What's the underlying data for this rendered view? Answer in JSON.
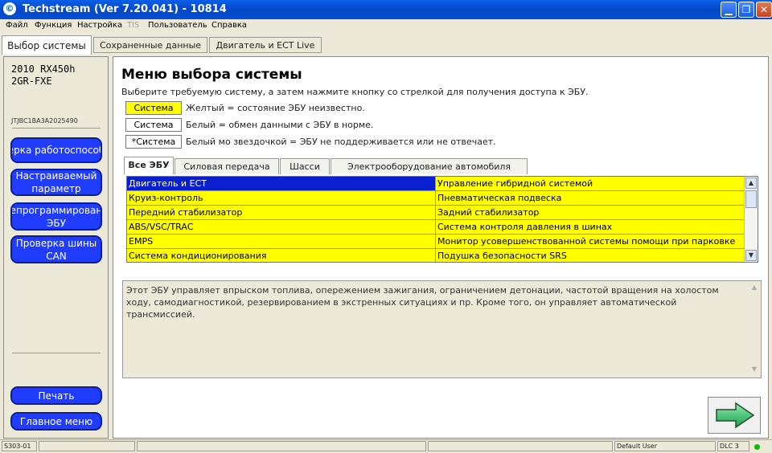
{
  "window": {
    "title": "Techstream (Ver 7.20.041) - 10814"
  },
  "menu": [
    "Файл",
    "Функция",
    "Настройка",
    "TIS",
    "Пользователь",
    "Справка"
  ],
  "top_tabs": [
    "Выбор системы",
    "Сохраненные данные",
    "Двигатель и ECT Live"
  ],
  "vehicle": {
    "model": "2010 RX450h",
    "engine": "2GR-FXE",
    "vin": "JTJBC1BA3A2025490"
  },
  "left_buttons": [
    "ерка работоспособ",
    "Настраиваемый параметр",
    "репрограммировани ЭБУ",
    "Проверка шины CAN"
  ],
  "bottom_buttons": [
    "Печать",
    "Главное меню"
  ],
  "main": {
    "title": "Меню выбора системы",
    "instruction": "Выберите требуемую систему, а затем нажмите кнопку со стрелкой для получения доступа к ЭБУ.",
    "legend": [
      {
        "box": "Система",
        "text": "Желтый = состояние ЭБУ неизвестно.",
        "color": "#ffff00"
      },
      {
        "box": "Система",
        "text": "Белый = обмен данными с ЭБУ в норме.",
        "color": "#ffffff"
      },
      {
        "box": "*Система",
        "text": "Белый мо звездочкой = ЭБУ не поддерживается или не отвечает.",
        "color": "#ffffff"
      }
    ],
    "sub_tabs": [
      "Все ЭБУ",
      "Силовая передача",
      "Шасси",
      "Электрооборудование автомобиля"
    ],
    "ecu_rows": [
      [
        "Двигатель и ECT",
        "Управление гибридной системой"
      ],
      [
        "Круиз-контроль",
        "Пневматическая подвеска"
      ],
      [
        "Передний стабилизатор",
        "Задний стабилизатор"
      ],
      [
        "ABS/VSC/TRAC",
        "Система контроля давления в шинах"
      ],
      [
        "EMPS",
        "Монитор усовершенствованной системы помощи при парковке"
      ],
      [
        "Система кондиционирования",
        "Подушка безопасности SRS"
      ]
    ],
    "description": "Этот ЭБУ управляет впрыском топлива, опережением зажигания, ограничением детонации, частотой вращения на холостом ходу, самодиагностикой, резервированием в экстренных ситуациях и пр. Кроме того, он управляет автоматической трансмиссией."
  },
  "status": {
    "code": "S303-01",
    "user": "Default User",
    "dlc": "DLC 3"
  },
  "colors": {
    "selected": "#0a1fd0",
    "ecu_unknown": "#ffff00",
    "button_blue": "#1f3cff",
    "connected": "#00c000"
  }
}
